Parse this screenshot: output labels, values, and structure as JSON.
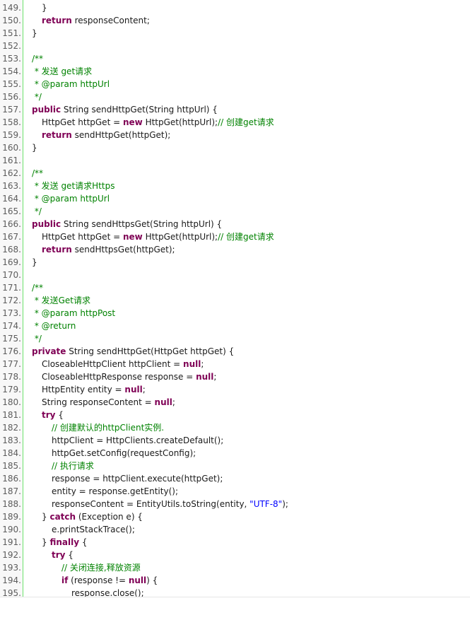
{
  "colors": {
    "keyword": "#7f0055",
    "comment": "#008200",
    "string": "#0000ff",
    "line_number": "#5c5c5c",
    "gutter_border": "#6ce26c"
  },
  "lines": [
    {
      "n": "149.",
      "indent": 2,
      "tokens": [
        {
          "t": "pl",
          "v": "}"
        }
      ]
    },
    {
      "n": "150.",
      "indent": 2,
      "tokens": [
        {
          "t": "kw",
          "v": "return"
        },
        {
          "t": "pl",
          "v": " responseContent;"
        }
      ]
    },
    {
      "n": "151.",
      "indent": 1,
      "tokens": [
        {
          "t": "pl",
          "v": "}"
        }
      ]
    },
    {
      "n": "152.",
      "indent": 0,
      "tokens": []
    },
    {
      "n": "153.",
      "indent": 1,
      "tokens": [
        {
          "t": "cm",
          "v": "/**"
        }
      ]
    },
    {
      "n": "154.",
      "indent": 1,
      "tokens": [
        {
          "t": "cm",
          "v": " * 发送 get请求"
        }
      ]
    },
    {
      "n": "155.",
      "indent": 1,
      "tokens": [
        {
          "t": "cm",
          "v": " * @param httpUrl"
        }
      ]
    },
    {
      "n": "156.",
      "indent": 1,
      "tokens": [
        {
          "t": "cm",
          "v": " */"
        }
      ]
    },
    {
      "n": "157.",
      "indent": 1,
      "tokens": [
        {
          "t": "kw",
          "v": "public"
        },
        {
          "t": "pl",
          "v": " String sendHttpGet(String httpUrl) {"
        }
      ]
    },
    {
      "n": "158.",
      "indent": 2,
      "tokens": [
        {
          "t": "pl",
          "v": "HttpGet httpGet = "
        },
        {
          "t": "kw",
          "v": "new"
        },
        {
          "t": "pl",
          "v": " HttpGet(httpUrl);"
        },
        {
          "t": "cm",
          "v": "// 创建get请求"
        }
      ]
    },
    {
      "n": "159.",
      "indent": 2,
      "tokens": [
        {
          "t": "kw",
          "v": "return"
        },
        {
          "t": "pl",
          "v": " sendHttpGet(httpGet);"
        }
      ]
    },
    {
      "n": "160.",
      "indent": 1,
      "tokens": [
        {
          "t": "pl",
          "v": "}"
        }
      ]
    },
    {
      "n": "161.",
      "indent": 0,
      "tokens": []
    },
    {
      "n": "162.",
      "indent": 1,
      "tokens": [
        {
          "t": "cm",
          "v": "/**"
        }
      ]
    },
    {
      "n": "163.",
      "indent": 1,
      "tokens": [
        {
          "t": "cm",
          "v": " * 发送 get请求Https"
        }
      ]
    },
    {
      "n": "164.",
      "indent": 1,
      "tokens": [
        {
          "t": "cm",
          "v": " * @param httpUrl"
        }
      ]
    },
    {
      "n": "165.",
      "indent": 1,
      "tokens": [
        {
          "t": "cm",
          "v": " */"
        }
      ]
    },
    {
      "n": "166.",
      "indent": 1,
      "tokens": [
        {
          "t": "kw",
          "v": "public"
        },
        {
          "t": "pl",
          "v": " String sendHttpsGet(String httpUrl) {"
        }
      ]
    },
    {
      "n": "167.",
      "indent": 2,
      "tokens": [
        {
          "t": "pl",
          "v": "HttpGet httpGet = "
        },
        {
          "t": "kw",
          "v": "new"
        },
        {
          "t": "pl",
          "v": " HttpGet(httpUrl);"
        },
        {
          "t": "cm",
          "v": "// 创建get请求"
        }
      ]
    },
    {
      "n": "168.",
      "indent": 2,
      "tokens": [
        {
          "t": "kw",
          "v": "return"
        },
        {
          "t": "pl",
          "v": " sendHttpsGet(httpGet);"
        }
      ]
    },
    {
      "n": "169.",
      "indent": 1,
      "tokens": [
        {
          "t": "pl",
          "v": "}"
        }
      ]
    },
    {
      "n": "170.",
      "indent": 0,
      "tokens": []
    },
    {
      "n": "171.",
      "indent": 1,
      "tokens": [
        {
          "t": "cm",
          "v": "/**"
        }
      ]
    },
    {
      "n": "172.",
      "indent": 1,
      "tokens": [
        {
          "t": "cm",
          "v": " * 发送Get请求"
        }
      ]
    },
    {
      "n": "173.",
      "indent": 1,
      "tokens": [
        {
          "t": "cm",
          "v": " * @param httpPost"
        }
      ]
    },
    {
      "n": "174.",
      "indent": 1,
      "tokens": [
        {
          "t": "cm",
          "v": " * @return"
        }
      ]
    },
    {
      "n": "175.",
      "indent": 1,
      "tokens": [
        {
          "t": "cm",
          "v": " */"
        }
      ]
    },
    {
      "n": "176.",
      "indent": 1,
      "tokens": [
        {
          "t": "kw",
          "v": "private"
        },
        {
          "t": "pl",
          "v": " String sendHttpGet(HttpGet httpGet) {"
        }
      ]
    },
    {
      "n": "177.",
      "indent": 2,
      "tokens": [
        {
          "t": "pl",
          "v": "CloseableHttpClient httpClient = "
        },
        {
          "t": "kw",
          "v": "null"
        },
        {
          "t": "pl",
          "v": ";"
        }
      ]
    },
    {
      "n": "178.",
      "indent": 2,
      "tokens": [
        {
          "t": "pl",
          "v": "CloseableHttpResponse response = "
        },
        {
          "t": "kw",
          "v": "null"
        },
        {
          "t": "pl",
          "v": ";"
        }
      ]
    },
    {
      "n": "179.",
      "indent": 2,
      "tokens": [
        {
          "t": "pl",
          "v": "HttpEntity entity = "
        },
        {
          "t": "kw",
          "v": "null"
        },
        {
          "t": "pl",
          "v": ";"
        }
      ]
    },
    {
      "n": "180.",
      "indent": 2,
      "tokens": [
        {
          "t": "pl",
          "v": "String responseContent = "
        },
        {
          "t": "kw",
          "v": "null"
        },
        {
          "t": "pl",
          "v": ";"
        }
      ]
    },
    {
      "n": "181.",
      "indent": 2,
      "tokens": [
        {
          "t": "kw",
          "v": "try"
        },
        {
          "t": "pl",
          "v": " {"
        }
      ]
    },
    {
      "n": "182.",
      "indent": 3,
      "tokens": [
        {
          "t": "cm",
          "v": "// 创建默认的httpClient实例."
        }
      ]
    },
    {
      "n": "183.",
      "indent": 3,
      "tokens": [
        {
          "t": "pl",
          "v": "httpClient = HttpClients.createDefault();"
        }
      ]
    },
    {
      "n": "184.",
      "indent": 3,
      "tokens": [
        {
          "t": "pl",
          "v": "httpGet.setConfig(requestConfig);"
        }
      ]
    },
    {
      "n": "185.",
      "indent": 3,
      "tokens": [
        {
          "t": "cm",
          "v": "// 执行请求"
        }
      ]
    },
    {
      "n": "186.",
      "indent": 3,
      "tokens": [
        {
          "t": "pl",
          "v": "response = httpClient.execute(httpGet);"
        }
      ]
    },
    {
      "n": "187.",
      "indent": 3,
      "tokens": [
        {
          "t": "pl",
          "v": "entity = response.getEntity();"
        }
      ]
    },
    {
      "n": "188.",
      "indent": 3,
      "tokens": [
        {
          "t": "pl",
          "v": "responseContent = EntityUtils.toString(entity, "
        },
        {
          "t": "st",
          "v": "\"UTF-8\""
        },
        {
          "t": "pl",
          "v": ");"
        }
      ]
    },
    {
      "n": "189.",
      "indent": 2,
      "tokens": [
        {
          "t": "pl",
          "v": "} "
        },
        {
          "t": "kw",
          "v": "catch"
        },
        {
          "t": "pl",
          "v": " (Exception e) {"
        }
      ]
    },
    {
      "n": "190.",
      "indent": 3,
      "tokens": [
        {
          "t": "pl",
          "v": "e.printStackTrace();"
        }
      ]
    },
    {
      "n": "191.",
      "indent": 2,
      "tokens": [
        {
          "t": "pl",
          "v": "} "
        },
        {
          "t": "kw",
          "v": "finally"
        },
        {
          "t": "pl",
          "v": " {"
        }
      ]
    },
    {
      "n": "192.",
      "indent": 3,
      "tokens": [
        {
          "t": "kw",
          "v": "try"
        },
        {
          "t": "pl",
          "v": " {"
        }
      ]
    },
    {
      "n": "193.",
      "indent": 4,
      "tokens": [
        {
          "t": "cm",
          "v": "// 关闭连接,释放资源"
        }
      ]
    },
    {
      "n": "194.",
      "indent": 4,
      "tokens": [
        {
          "t": "kw",
          "v": "if"
        },
        {
          "t": "pl",
          "v": " (response != "
        },
        {
          "t": "kw",
          "v": "null"
        },
        {
          "t": "pl",
          "v": ") {"
        }
      ]
    },
    {
      "n": "195.",
      "indent": 5,
      "tokens": [
        {
          "t": "pl",
          "v": "response.close();"
        }
      ]
    }
  ]
}
